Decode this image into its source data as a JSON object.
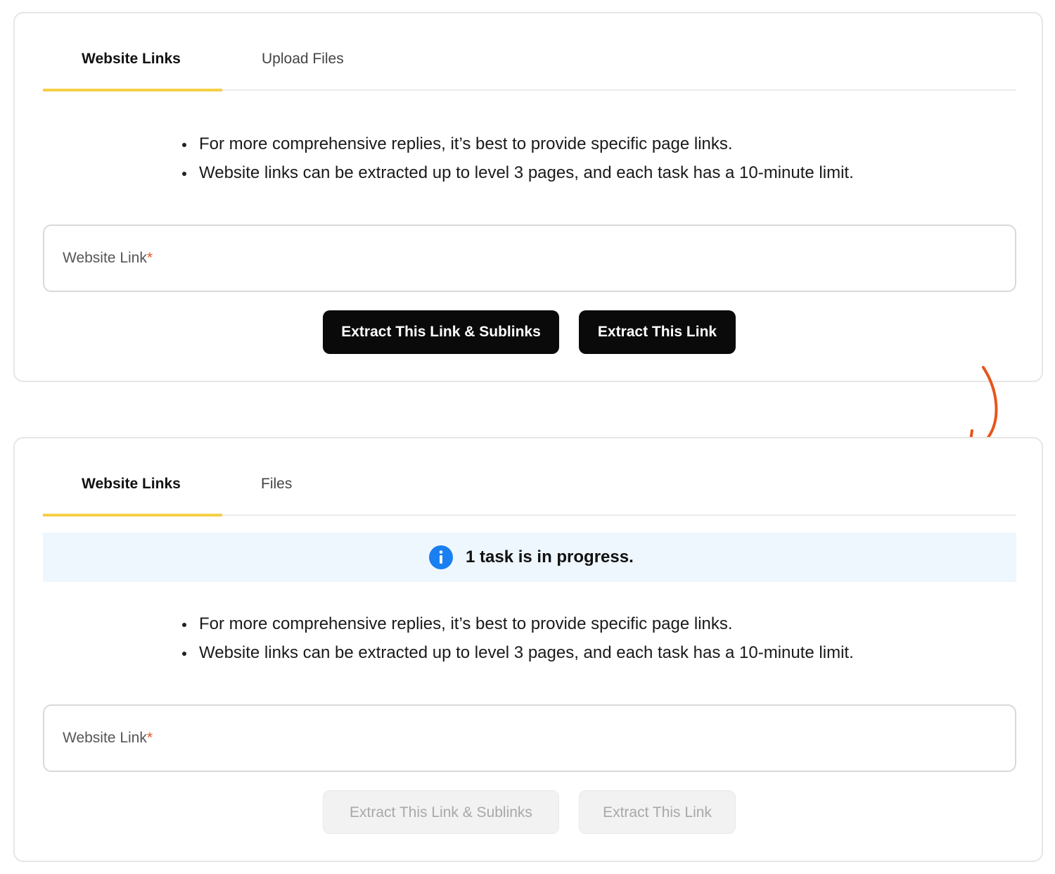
{
  "panel_before": {
    "tabs": [
      {
        "label": "Website Links",
        "active": true
      },
      {
        "label": "Upload Files",
        "active": false
      }
    ],
    "notes": [
      "For more comprehensive replies, it’s best to provide specific page links.",
      "Website links can be extracted up to level 3 pages, and each task has a 10-minute limit."
    ],
    "input": {
      "label": "Website Link",
      "required_mark": "*",
      "value": ""
    },
    "buttons": {
      "extract_sublinks": "Extract This Link & Sublinks",
      "extract_link": "Extract This Link",
      "enabled": true
    }
  },
  "panel_after": {
    "tabs": [
      {
        "label": "Website Links",
        "active": true
      },
      {
        "label": "Files",
        "active": false
      }
    ],
    "banner": {
      "icon": "info-icon",
      "text": "1 task is in progress."
    },
    "notes": [
      "For more comprehensive replies, it’s best to provide specific page links.",
      "Website links can be extracted up to level 3 pages, and each task has a 10-minute limit."
    ],
    "input": {
      "label": "Website Link",
      "required_mark": "*",
      "value": ""
    },
    "buttons": {
      "extract_sublinks": "Extract This Link & Sublinks",
      "extract_link": "Extract This Link",
      "enabled": false
    }
  },
  "transition_arrow": {
    "icon": "curved-arrow-down-icon",
    "color": "#e8541c"
  },
  "colors": {
    "tab_active_underline": "#f5d046",
    "banner_bg": "#eef6fe",
    "info_icon": "#1a7ff0",
    "button_dark": "#0a0a0a",
    "required_mark": "#e4572e"
  }
}
